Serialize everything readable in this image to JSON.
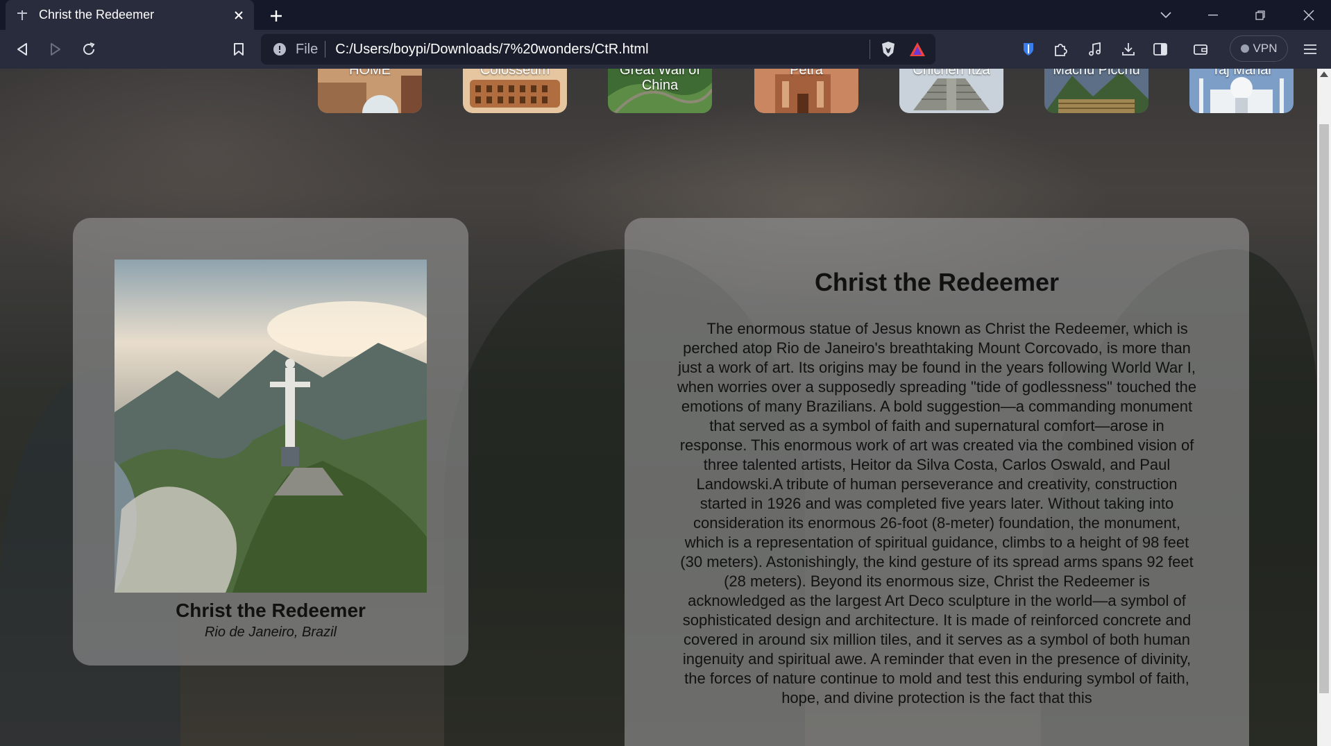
{
  "browser": {
    "tab_title": "Christ the Redeemer",
    "url_scheme": "File",
    "url": "C:/Users/boypi/Downloads/7%20wonders/CtR.html",
    "vpn_label": "VPN"
  },
  "nav": {
    "items": [
      {
        "label": "HOME",
        "colors": [
          "#8a5a3a",
          "#c9a07a"
        ]
      },
      {
        "label": "Colosseum",
        "colors": [
          "#a8663a",
          "#e2b58a"
        ]
      },
      {
        "label": "Great Wall of China",
        "colors": [
          "#2f5a2a",
          "#6f9a52"
        ]
      },
      {
        "label": "Petra",
        "colors": [
          "#8e4f2f",
          "#d39a6c"
        ]
      },
      {
        "label": "Chichen Itza",
        "colors": [
          "#7d8a9a",
          "#c8ccd0"
        ]
      },
      {
        "label": "Machu Picchu",
        "colors": [
          "#4a5f78",
          "#a38d5a"
        ]
      },
      {
        "label": "Taj Mahal",
        "colors": [
          "#6f8fb8",
          "#e8eef5"
        ]
      }
    ]
  },
  "card": {
    "title": "Christ the Redeemer",
    "location": "Rio de Janeiro, Brazil"
  },
  "article": {
    "title": "Christ the Redeemer",
    "body": "     The enormous statue of Jesus known as Christ the Redeemer, which is perched atop Rio de Janeiro's breathtaking Mount Corcovado, is more than just a work of art. Its origins may be found in the years following World War I, when worries over a supposedly spreading \"tide of godlessness\" touched the emotions of many Brazilians. A bold suggestion—a commanding monument that served as a symbol of faith and supernatural comfort—arose in response. This enormous work of art was created via the combined vision of three talented artists, Heitor da Silva Costa, Carlos Oswald, and Paul Landowski.A tribute of human perseverance and creativity, construction started in 1926 and was completed five years later. Without taking into consideration its enormous 26-foot (8-meter) foundation, the monument, which is a representation of spiritual guidance, climbs to a height of 98 feet (30 meters). Astonishingly, the kind gesture of its spread arms spans 92 feet (28 meters). Beyond its enormous size, Christ the Redeemer is acknowledged as the largest Art Deco sculpture in the world—a symbol of sophisticated design and architecture. It is made of reinforced concrete and covered in around six million tiles, and it serves as a symbol of both human ingenuity and spiritual awe. A reminder that even in the presence of divinity, the forces of nature continue to mold and test this enduring symbol of faith, hope, and divine protection is the fact that this"
  },
  "colors": {
    "tabbar": "#151828",
    "toolbar": "#292c3d",
    "panel": "rgba(150,150,150,0.62)"
  }
}
